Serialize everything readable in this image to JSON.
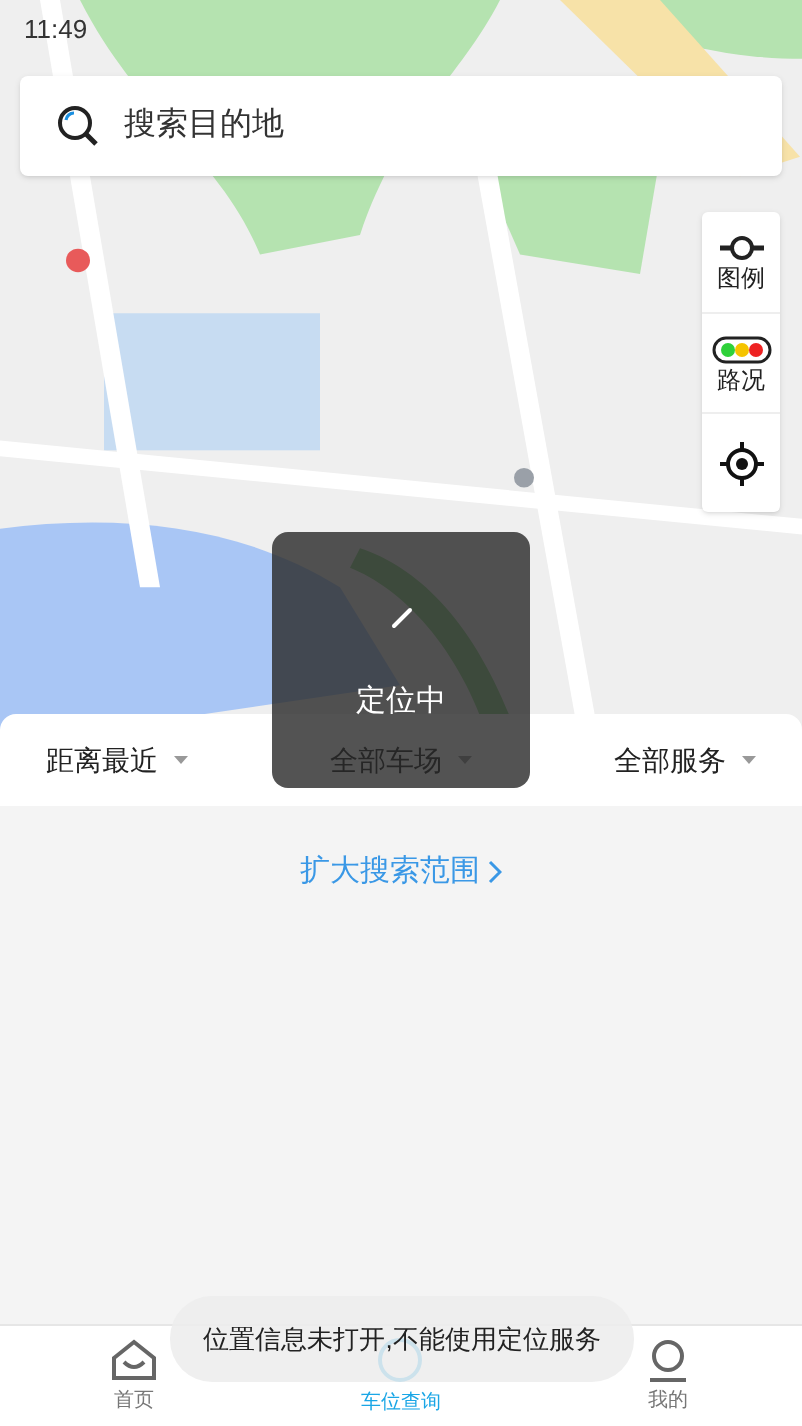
{
  "status_bar": {
    "time": "11:49"
  },
  "search": {
    "placeholder": "搜索目的地"
  },
  "map_controls": [
    {
      "kind": "legend",
      "label": "图例"
    },
    {
      "kind": "traffic",
      "label": "路况"
    },
    {
      "kind": "locate"
    }
  ],
  "filters": [
    {
      "label": "距离最近"
    },
    {
      "label": "全部车场"
    },
    {
      "label": "全部服务"
    }
  ],
  "expand_link": "扩大搜索范围",
  "loading": {
    "text": "定位中"
  },
  "nav": [
    {
      "kind": "home",
      "label": "首页",
      "selected": false
    },
    {
      "kind": "parking",
      "label": "车位查询",
      "selected": true
    },
    {
      "kind": "me",
      "label": "我的",
      "selected": false
    }
  ],
  "toast": "位置信息未打开,不能使用定位服务"
}
